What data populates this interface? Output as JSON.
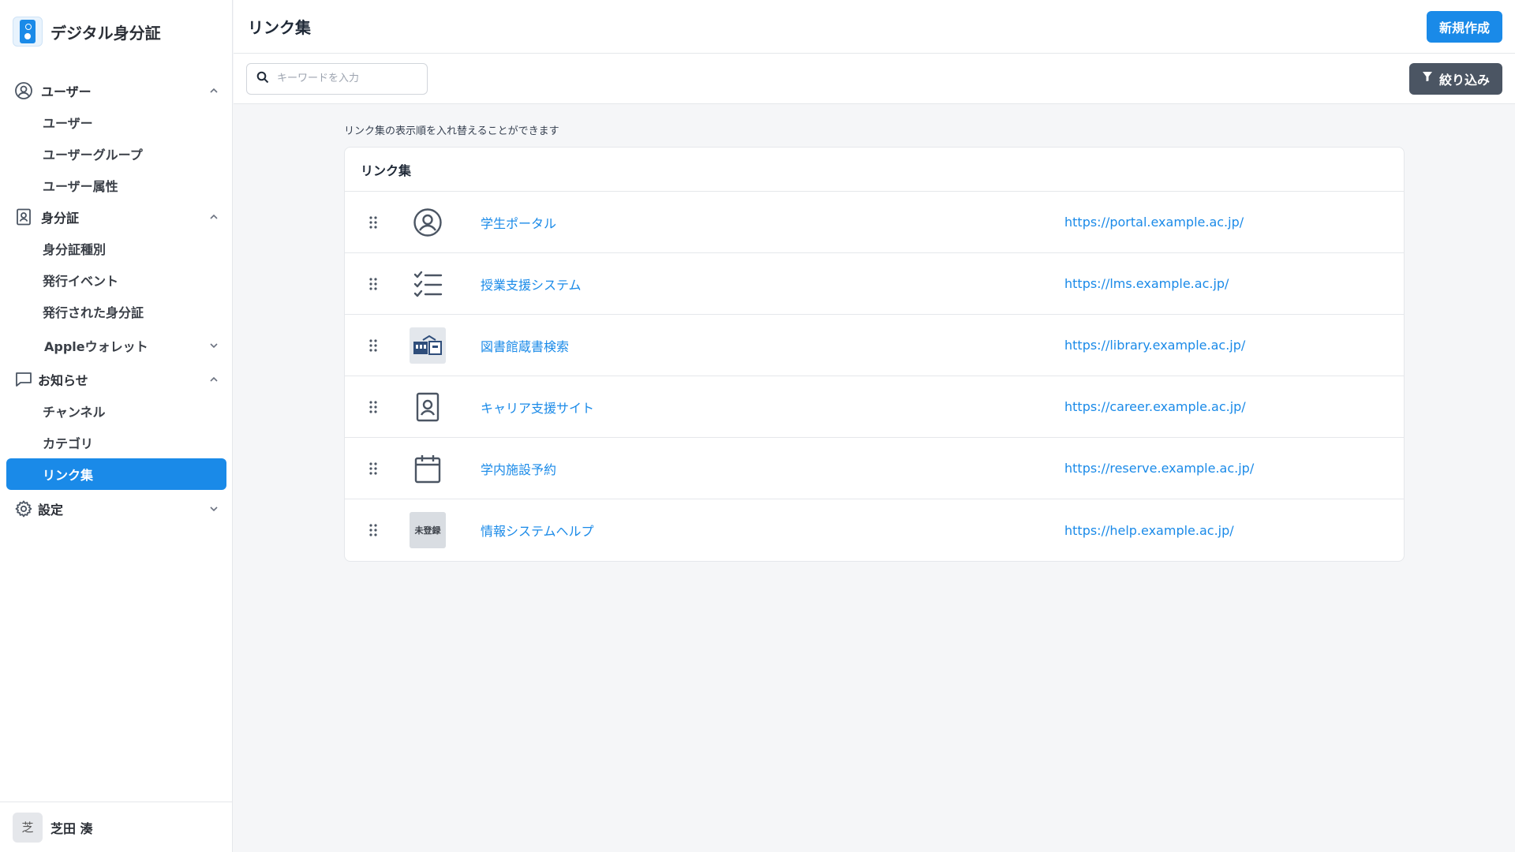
{
  "app": {
    "name": "デジタル身分証"
  },
  "sidebar": {
    "groups": [
      {
        "label": "ユーザー",
        "items": [
          "ユーザー",
          "ユーザーグループ",
          "ユーザー属性"
        ]
      },
      {
        "label": "身分証",
        "items": [
          "身分証種別",
          "発行イベント",
          "発行された身分証"
        ],
        "subgroup": "Appleウォレット"
      },
      {
        "label": "お知らせ",
        "items": [
          "チャンネル",
          "カテゴリ",
          "リンク集"
        ]
      },
      {
        "label": "設定"
      }
    ],
    "active_item": "リンク集"
  },
  "user": {
    "avatar_char": "芝",
    "name": "芝田 湊"
  },
  "header": {
    "title": "リンク集",
    "new_button": "新規作成"
  },
  "toolbar": {
    "search_placeholder": "キーワードを入力",
    "filter_label": "絞り込み"
  },
  "main": {
    "hint": "リンク集の表示順を入れ替えることができます",
    "panel_title": "リンク集",
    "links": [
      {
        "name": "学生ポータル",
        "url": "https://portal.example.ac.jp/",
        "icon": "user-circle-icon"
      },
      {
        "name": "授業支援システム",
        "url": "https://lms.example.ac.jp/",
        "icon": "checklist-icon"
      },
      {
        "name": "図書館蔵書検索",
        "url": "https://library.example.ac.jp/",
        "icon": "library-image-icon"
      },
      {
        "name": "キャリア支援サイト",
        "url": "https://career.example.ac.jp/",
        "icon": "id-badge-icon"
      },
      {
        "name": "学内施設予約",
        "url": "https://reserve.example.ac.jp/",
        "icon": "calendar-icon"
      },
      {
        "name": "情報システムヘルプ",
        "url": "https://help.example.ac.jp/",
        "icon": "unregistered-icon",
        "icon_text": "未登録"
      }
    ]
  },
  "colors": {
    "primary": "#1a8ae8",
    "filter_button": "#4b5563"
  }
}
